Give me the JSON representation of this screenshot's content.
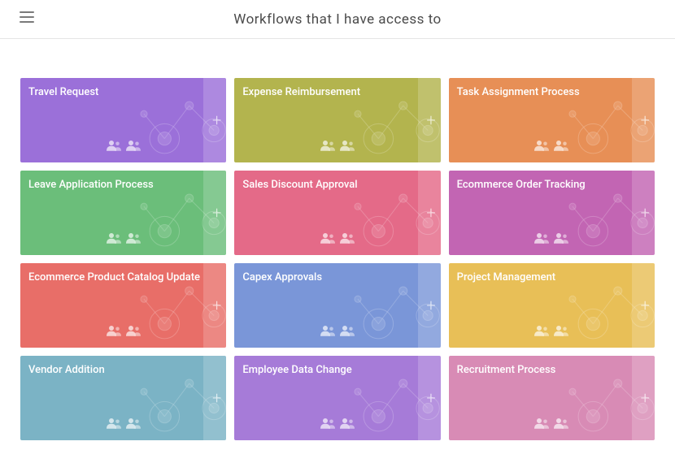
{
  "header": {
    "title": "Workflows that I have access to"
  },
  "workflows": [
    {
      "title": "Travel Request",
      "color": "#9B70D9"
    },
    {
      "title": "Expense Reimbursement",
      "color": "#B3B44E"
    },
    {
      "title": "Task Assignment Process",
      "color": "#E78F56"
    },
    {
      "title": "Leave Application Process",
      "color": "#6BBE7A"
    },
    {
      "title": "Sales Discount Approval",
      "color": "#E46A88"
    },
    {
      "title": "Ecommerce Order Tracking",
      "color": "#C265B3"
    },
    {
      "title": "Ecommerce Product Catalog Update",
      "color": "#E86E68"
    },
    {
      "title": "Capex Approvals",
      "color": "#7A96D8"
    },
    {
      "title": "Project Management",
      "color": "#E8BF57"
    },
    {
      "title": "Vendor Addition",
      "color": "#7BB3C5"
    },
    {
      "title": "Employee Data Change",
      "color": "#A67BD8"
    },
    {
      "title": "Recruitment Process",
      "color": "#D88BB5"
    }
  ]
}
